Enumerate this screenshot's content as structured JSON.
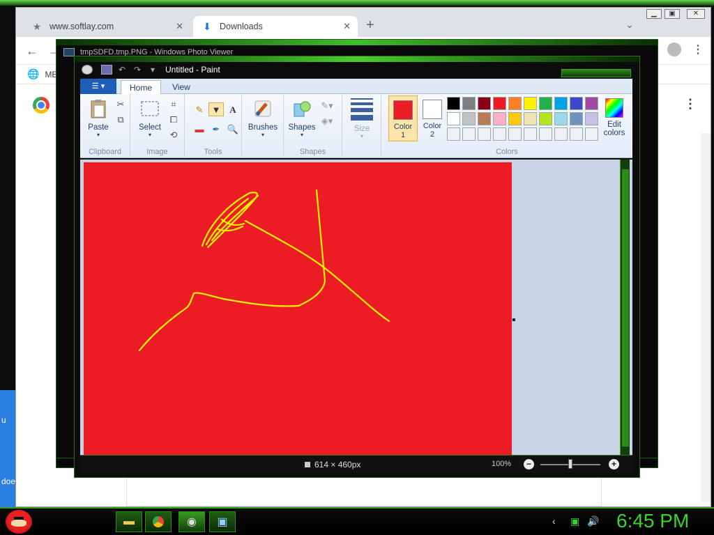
{
  "desktop": {
    "left_text_1": "u",
    "left_text_2": "doe"
  },
  "browser": {
    "tabs": [
      {
        "label": "www.softlay.com",
        "icon": "star-icon"
      },
      {
        "label": "Downloads",
        "icon": "download-icon",
        "active": true
      }
    ],
    "new_tab": "+",
    "bookmark_label": "ME"
  },
  "photo_viewer": {
    "title": "tmpSDFD.tmp.PNG - Windows Photo Viewer"
  },
  "paint": {
    "title": "Untitled - Paint",
    "file_menu": "▾",
    "tabs": [
      "Home",
      "View"
    ],
    "groups": {
      "clipboard": {
        "label": "Clipboard",
        "paste": "Paste"
      },
      "image": {
        "label": "Image",
        "select": "Select"
      },
      "tools": {
        "label": "Tools"
      },
      "shapes": {
        "label": "Shapes",
        "brushes": "Brushes",
        "shapes": "Shapes"
      },
      "size": {
        "label": "Size"
      },
      "colors": {
        "label": "Colors",
        "color1": "Color\n1",
        "color1_line1": "Color",
        "color1_line2": "1",
        "color2_line1": "Color",
        "color2_line2": "2",
        "edit_line1": "Edit",
        "edit_line2": "colors",
        "color1_value": "#ec1c24",
        "color2_value": "#ffffff",
        "palette_row1": [
          "#000000",
          "#7f7f7f",
          "#880015",
          "#ed1c24",
          "#ff7f27",
          "#fff200",
          "#22b14c",
          "#00a2e8",
          "#3f48cc",
          "#a349a4"
        ],
        "palette_row2": [
          "#ffffff",
          "#c3c3c3",
          "#b97a57",
          "#ffaec9",
          "#ffc90e",
          "#efe4b0",
          "#b5e61d",
          "#99d9ea",
          "#7092be",
          "#c8bfe7"
        ]
      }
    },
    "canvas": {
      "background": "#ec1c24",
      "stroke_color": "#fff200"
    },
    "status": {
      "dimensions": "614 × 460px",
      "zoom": "100%"
    }
  },
  "taskbar": {
    "clock": "6:45 PM"
  }
}
